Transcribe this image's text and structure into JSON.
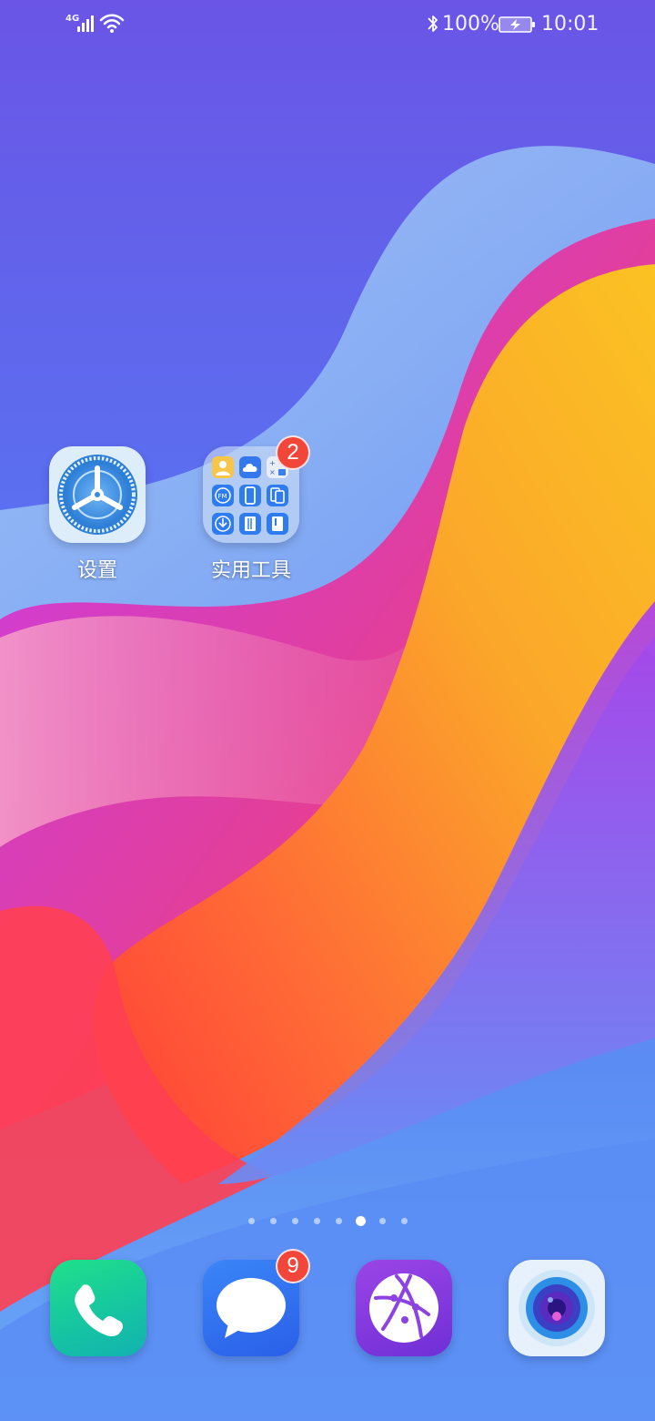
{
  "status_bar": {
    "network": "4G",
    "battery_percent": "100%",
    "time": "10:01",
    "icons": [
      "signal-icon",
      "wifi-icon",
      "bluetooth-icon",
      "battery-charging-icon"
    ]
  },
  "home": {
    "apps": [
      {
        "label": "设置",
        "icon": "settings-gear-icon"
      },
      {
        "label": "实用工具",
        "icon": "folder-icon",
        "badge": "2",
        "contents": [
          "contacts-icon",
          "cloud-icon",
          "calculator-icon",
          "fm-radio-icon",
          "phone-clone-icon",
          "mirror-icon",
          "download-icon",
          "notepad-icon",
          "files-icon"
        ]
      }
    ],
    "page_indicator": {
      "count": 8,
      "active_index": 5
    }
  },
  "dock": [
    {
      "name": "phone",
      "icon": "phone-icon"
    },
    {
      "name": "messages",
      "icon": "message-bubble-icon",
      "badge": "9"
    },
    {
      "name": "browser",
      "icon": "globe-icon"
    },
    {
      "name": "camera",
      "icon": "camera-lens-icon"
    }
  ],
  "colors": {
    "badge": "#f2463b",
    "phone": "#15c79a",
    "messages": "#2f6ef2",
    "browser": "#8a3de0",
    "camera_outer": "#eaf3fc"
  }
}
